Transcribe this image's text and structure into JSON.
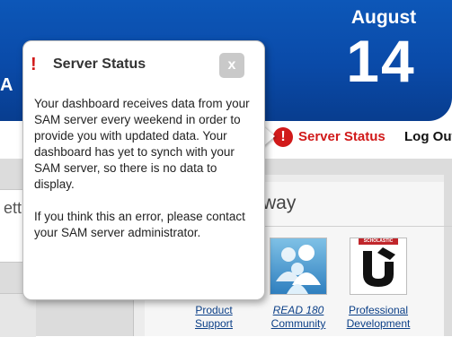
{
  "header": {
    "cut_letter": "A",
    "date": {
      "month": "August",
      "day": "14"
    }
  },
  "status_bar": {
    "server_status_label": "Server Status",
    "logout_label": "Log Out"
  },
  "left_panel": {
    "cut_text": "ett"
  },
  "pathway": {
    "title_fragment": "way"
  },
  "tiles": [
    {
      "label_line1": "Product",
      "label_line2": "Support",
      "icon": "product-support-icon"
    },
    {
      "label_line1": "READ 180",
      "label_line2": "Community",
      "icon": "community-people-icon"
    },
    {
      "label_line1": "Professional",
      "label_line2": "Development",
      "icon": "scholastic-u-logo-icon",
      "brand_tab": "SCHOLASTIC"
    }
  ],
  "popup": {
    "title": "Server Status",
    "alert_icon": "!",
    "close_label": "x",
    "paragraph1": "Your dashboard receives data from your SAM server every weekend in order to provide you with updated data. Your dashboard has yet to synch with your SAM server, so there is no data to display.",
    "paragraph2": "If you think this an error, please contact your SAM server administrator."
  },
  "colors": {
    "header_blue": "#0a4aa8",
    "alert_red": "#d11a1a",
    "link_blue": "#0b3f87"
  }
}
